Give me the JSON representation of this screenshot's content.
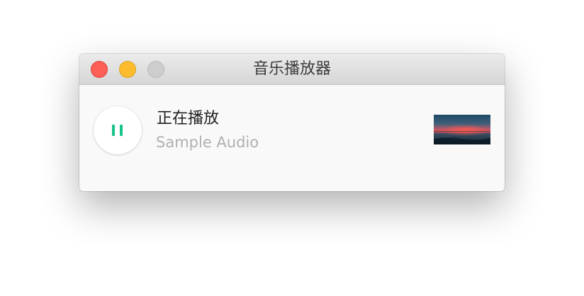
{
  "window": {
    "title": "音乐播放器"
  },
  "player": {
    "status": "正在播放",
    "track_name": "Sample Audio",
    "play_state": "playing",
    "control_icon": "pause-icon",
    "accent_color": "#18c38a",
    "cover_art": "sunset-over-water"
  },
  "traffic_lights": {
    "close_color": "#fd5f57",
    "minimize_color": "#fdbc2e",
    "maximize_color": "#cdcdcd"
  }
}
